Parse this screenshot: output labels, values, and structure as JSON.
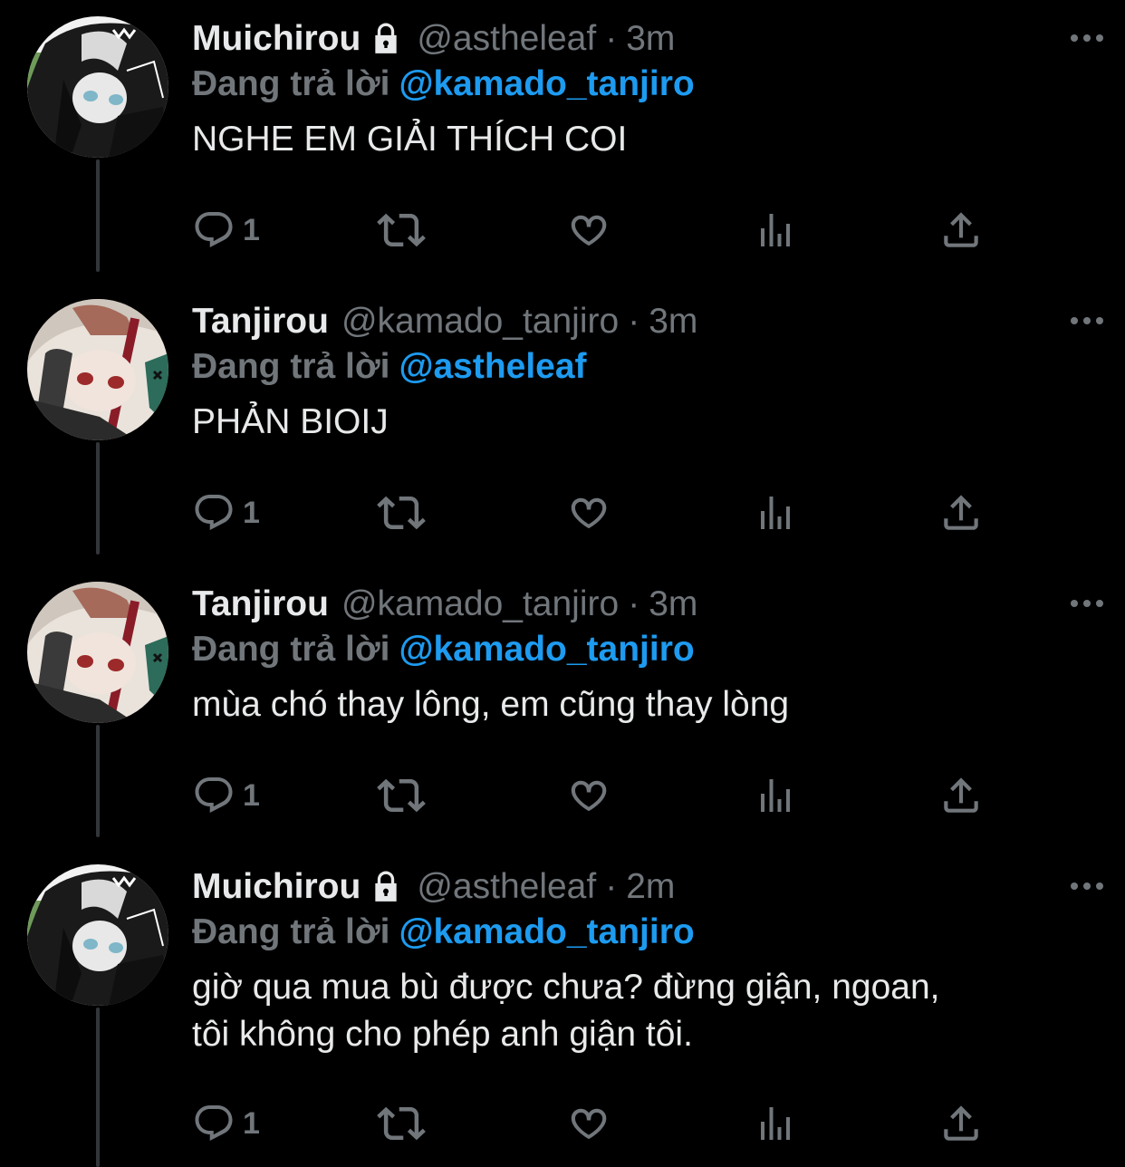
{
  "colors": {
    "background": "#000000",
    "text": "#e7e9ea",
    "secondary": "#71767b",
    "link": "#1d9bf0",
    "thread_line": "#333639"
  },
  "tweets": [
    {
      "display_name": "Muichirou",
      "protected": true,
      "handle": "@astheleaf",
      "separator": "·",
      "time": "3m",
      "reply_label": "Đang trả lời",
      "reply_to": "@kamado_tanjiro",
      "text": "NGHE EM GIẢI THÍCH COI",
      "reply_count": "1",
      "avatar": "muichirou-avatar"
    },
    {
      "display_name": "Tanjirou",
      "protected": false,
      "handle": "@kamado_tanjiro",
      "separator": "·",
      "time": "3m",
      "reply_label": "Đang trả lời",
      "reply_to": "@astheleaf",
      "text": "PHẢN BIOIJ",
      "reply_count": "1",
      "avatar": "tanjirou-avatar"
    },
    {
      "display_name": "Tanjirou",
      "protected": false,
      "handle": "@kamado_tanjiro",
      "separator": "·",
      "time": "3m",
      "reply_label": "Đang trả lời",
      "reply_to": "@kamado_tanjiro",
      "text": "mùa chó thay lông, em cũng thay lòng",
      "reply_count": "1",
      "avatar": "tanjirou-avatar"
    },
    {
      "display_name": "Muichirou",
      "protected": true,
      "handle": "@astheleaf",
      "separator": "·",
      "time": "2m",
      "reply_label": "Đang trả lời",
      "reply_to": "@kamado_tanjiro",
      "text_line1": "giờ qua mua bù được chưa? đừng giận, ngoan,",
      "text_line2": "tôi không cho phép anh giận tôi.",
      "reply_count": "1",
      "avatar": "muichirou-avatar"
    }
  ],
  "icons": {
    "reply": "reply-icon",
    "retweet": "retweet-icon",
    "like": "heart-icon",
    "analytics": "analytics-icon",
    "share": "share-icon",
    "more": "more-icon",
    "lock": "lock-icon"
  }
}
